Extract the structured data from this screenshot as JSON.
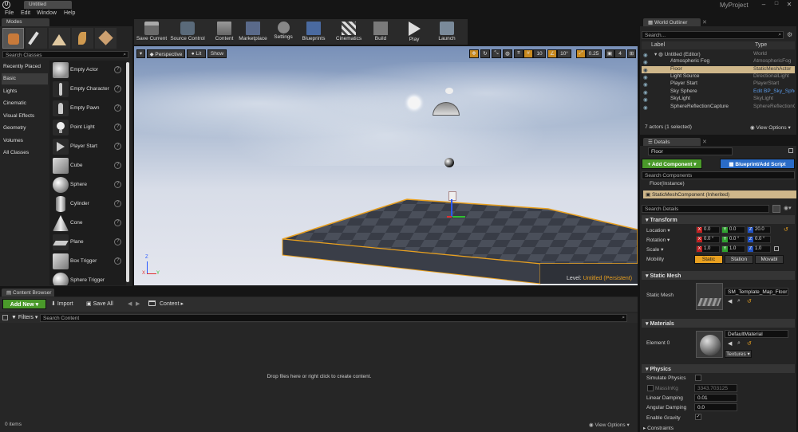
{
  "window": {
    "tab_title": "Untitled",
    "project": "MyProject",
    "menu": [
      "File",
      "Edit",
      "Window",
      "Help"
    ]
  },
  "modes": {
    "tab": "Modes",
    "search_placeholder": "Search Classes",
    "categories": [
      "Recently Placed",
      "Basic",
      "Lights",
      "Cinematic",
      "Visual Effects",
      "Geometry",
      "Volumes",
      "All Classes"
    ],
    "items": [
      "Empty Actor",
      "Empty Character",
      "Empty Pawn",
      "Point Light",
      "Player Start",
      "Cube",
      "Sphere",
      "Cylinder",
      "Cone",
      "Plane",
      "Box Trigger",
      "Sphere Trigger"
    ]
  },
  "toolbar": {
    "buttons": [
      "Save Current",
      "Source Control",
      "Content",
      "Marketplace",
      "Settings",
      "Blueprints",
      "Cinematics",
      "Build",
      "Play",
      "Launch"
    ]
  },
  "viewport": {
    "perspective": "Perspective",
    "lit": "Lit",
    "show": "Show",
    "grid_snap": "10",
    "rot_snap": "10°",
    "scale_snap": "0.25",
    "cam_speed": "4",
    "level_label": "Level:",
    "level_name": "Untitled (Persistent)",
    "axis_x": "X",
    "axis_y": "Y",
    "axis_z": "Z"
  },
  "outliner": {
    "tab": "World Outliner",
    "search_placeholder": "Search...",
    "col_label": "Label",
    "col_type": "Type",
    "rows": [
      {
        "name": "Untitled (Editor)",
        "type": "World"
      },
      {
        "name": "Atmospheric Fog",
        "type": "AtmosphericFog"
      },
      {
        "name": "Floor",
        "type": "StaticMeshActor"
      },
      {
        "name": "Light Source",
        "type": "DirectionalLight"
      },
      {
        "name": "Player Start",
        "type": "PlayerStart"
      },
      {
        "name": "Sky Sphere",
        "type": "Edit BP_Sky_Sphere"
      },
      {
        "name": "SkyLight",
        "type": "SkyLight"
      },
      {
        "name": "SphereReflectionCapture",
        "type": "SphereReflectionCapture"
      }
    ],
    "count": "7 actors (1 selected)",
    "view_options": "View Options"
  },
  "details": {
    "tab": "Details",
    "name_value": "Floor",
    "add_component": "+ Add Component",
    "blueprint_script": "Blueprint/Add Script",
    "search_components_placeholder": "Search Components",
    "instance_label": "Floor(Instance)",
    "component": "StaticMeshComponent (Inherited)",
    "search_details_placeholder": "Search Details",
    "transform": {
      "title": "Transform",
      "location_label": "Location",
      "rotation_label": "Rotation",
      "scale_label": "Scale",
      "mobility_label": "Mobility",
      "location": [
        "0.0",
        "0.0",
        "20.0"
      ],
      "rotation": [
        "0.0 °",
        "0.0 °",
        "0.0 °"
      ],
      "scale": [
        "1.0",
        "1.0",
        "1.0"
      ],
      "mobility_options": [
        "Static",
        "Station",
        "Movabl"
      ]
    },
    "static_mesh": {
      "title": "Static Mesh",
      "label": "Static Mesh",
      "value": "SM_Template_Map_Floor"
    },
    "materials": {
      "title": "Materials",
      "element_label": "Element 0",
      "value": "DefaultMaterial",
      "textures": "Textures"
    },
    "physics": {
      "title": "Physics",
      "simulate_label": "Simulate Physics",
      "mass_label": "MassInKg",
      "mass_value": "3343.703125",
      "linear_label": "Linear Damping",
      "linear_value": "0.01",
      "angular_label": "Angular Damping",
      "angular_value": "0.0",
      "gravity_label": "Enable Gravity",
      "constraints_label": "Constraints"
    }
  },
  "content_browser": {
    "tab": "Content Browser",
    "add_new": "Add New",
    "import": "Import",
    "save_all": "Save All",
    "path": "Content",
    "filters": "Filters",
    "search_placeholder": "Search Content",
    "empty_message": "Drop files here or right click to create content.",
    "items_count": "0 items",
    "view_options": "View Options"
  },
  "colors": {
    "accent_orange": "#e8a020",
    "selection_row": "#cfb78a",
    "add_green": "#4a9a2a",
    "blueprint_blue": "#2a6cc8"
  }
}
